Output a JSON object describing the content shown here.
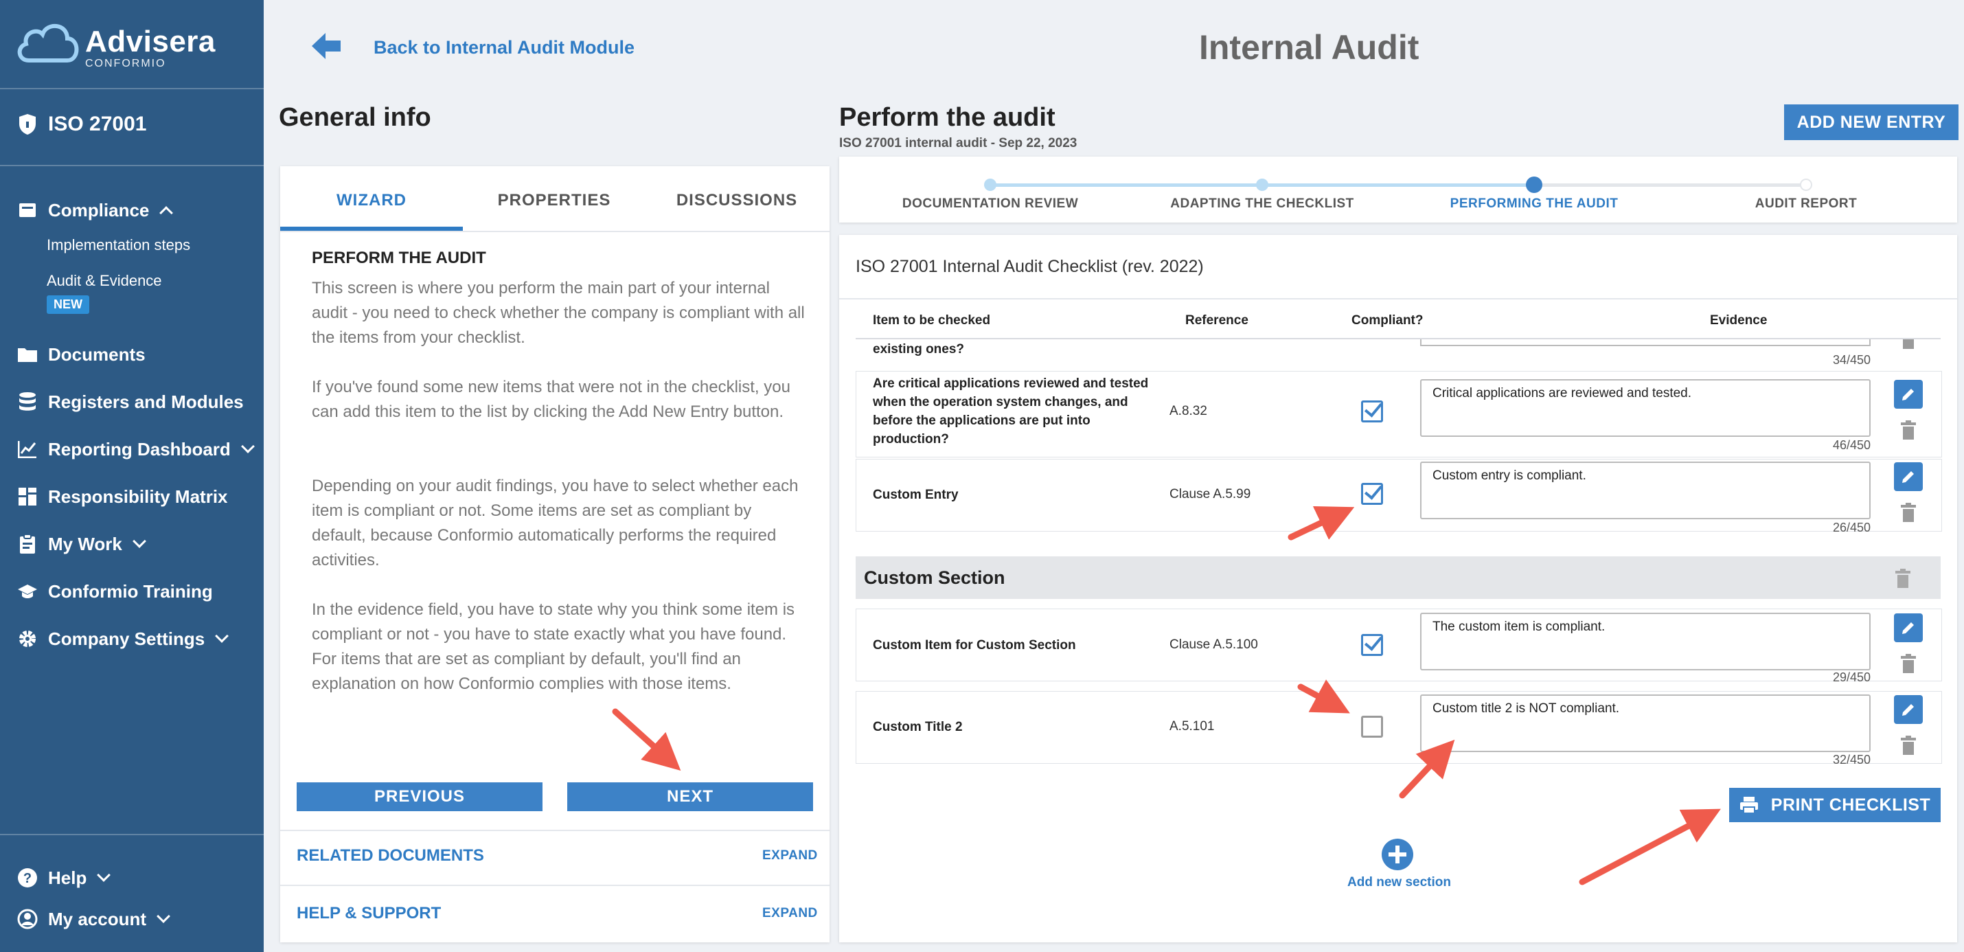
{
  "brand": {
    "name": "Advisera",
    "sub": "CONFORMIO"
  },
  "sidebar": {
    "standard": "ISO 27001",
    "compliance": "Compliance",
    "sub_items": [
      "Implementation steps",
      "Audit & Evidence"
    ],
    "new_badge": "NEW",
    "items": [
      "Documents",
      "Registers and Modules",
      "Reporting Dashboard",
      "Responsibility Matrix",
      "My Work",
      "Conformio Training",
      "Company Settings"
    ],
    "help": "Help",
    "account": "My account"
  },
  "header": {
    "back": "Back to Internal Audit Module",
    "title": "Internal Audit"
  },
  "left": {
    "title": "General info",
    "tabs": [
      "WIZARD",
      "PROPERTIES",
      "DISCUSSIONS"
    ],
    "wizard_title": "PERFORM THE AUDIT",
    "paragraphs": [
      "This screen is where you perform the main part of your internal audit - you need to check whether the company is compliant with all the items from your checklist.",
      "If you've found some new items that were not in the checklist, you can add this item to the list by clicking the Add New Entry button.",
      "Depending on your audit findings, you have to select whether each item is compliant or not. Some items are set as compliant by default, because Conformio automatically performs the required activities.",
      "In the evidence field, you have to state why you think some item is compliant or not - you have to state exactly what you have found. For items that are set as compliant by default, you'll find an explanation on how Conformio complies with those items."
    ],
    "previous": "PREVIOUS",
    "next": "NEXT",
    "related": "RELATED DOCUMENTS",
    "help_support": "HELP & SUPPORT",
    "expand": "EXPAND"
  },
  "right": {
    "title": "Perform the audit",
    "subtitle": "ISO 27001 internal audit - Sep 22, 2023",
    "add_entry": "ADD NEW ENTRY",
    "steps": [
      "DOCUMENTATION REVIEW",
      "ADAPTING THE CHECKLIST",
      "PERFORMING THE AUDIT",
      "AUDIT REPORT"
    ],
    "current_step": 3,
    "checklist_title": "ISO 27001 Internal Audit Checklist (rev. 2022)",
    "columns": [
      "Item to be checked",
      "Reference",
      "Compliant?",
      "Evidence"
    ],
    "partial_row": {
      "item": "existing ones?",
      "count": "34/450"
    },
    "rows": [
      {
        "item": "Are critical applications reviewed and tested when the operation system changes, and before the applications are put into production?",
        "ref": "A.8.32",
        "compliant": true,
        "evidence": "Critical applications are reviewed and tested.",
        "count": "46/450"
      },
      {
        "item": "Custom Entry",
        "ref": "Clause A.5.99",
        "compliant": true,
        "evidence": "Custom entry is compliant.",
        "count": "26/450"
      }
    ],
    "section": "Custom Section",
    "section_rows": [
      {
        "item": "Custom Item for Custom Section",
        "ref": "Clause A.5.100",
        "compliant": true,
        "evidence": "The custom item is compliant.",
        "count": "29/450"
      },
      {
        "item": "Custom Title 2",
        "ref": "A.5.101",
        "compliant": false,
        "evidence": "Custom title 2 is NOT compliant.",
        "count": "32/450"
      }
    ],
    "print": "PRINT CHECKLIST",
    "add_section": "Add new section"
  },
  "colors": {
    "sidebar": "#2d5a85",
    "accent": "#3d82c7",
    "annotation": "#ef5b4c"
  }
}
